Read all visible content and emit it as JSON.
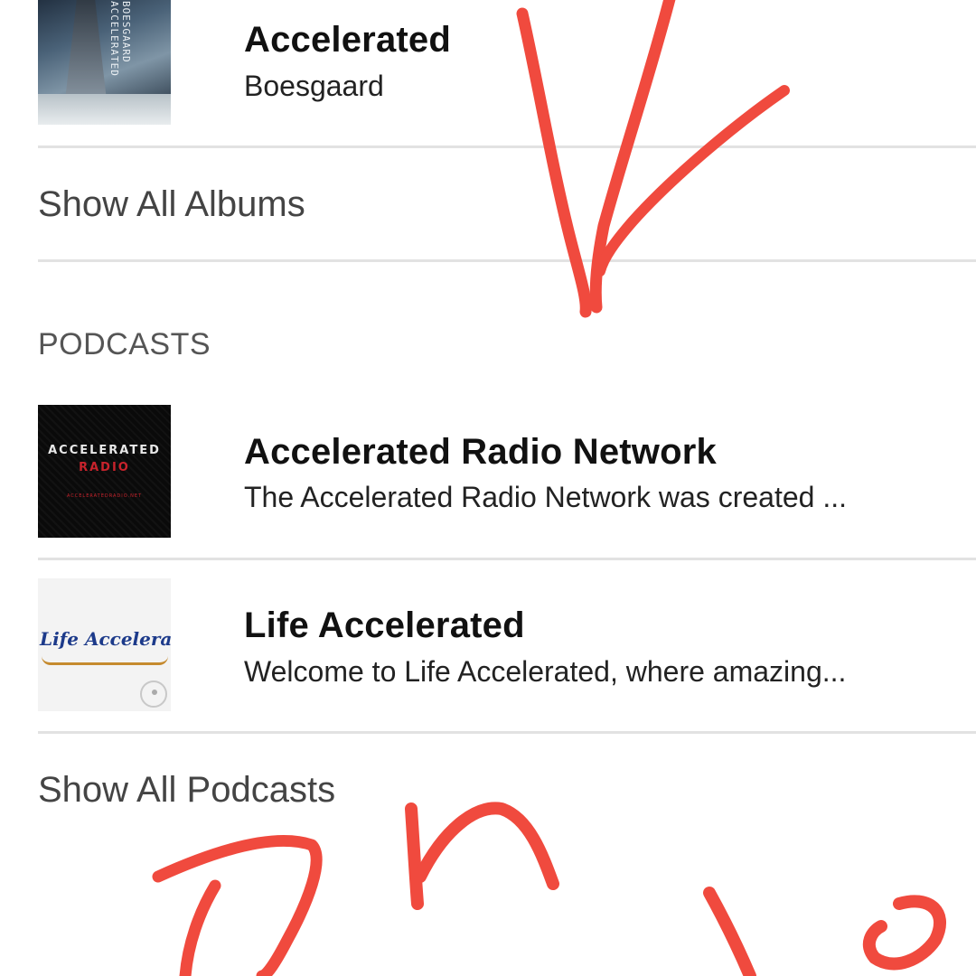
{
  "albums": {
    "items": [
      {
        "title": "Accelerated",
        "subtitle": "Boesgaard",
        "art_text": "BOESGAARD ACCELERATED"
      }
    ],
    "show_all_label": "Show All Albums"
  },
  "podcasts": {
    "section_title": "PODCASTS",
    "items": [
      {
        "title": "Accelerated Radio Network",
        "subtitle": "The Accelerated Radio Network was created ...",
        "art_line1": "ACCELERATED",
        "art_line2": "RADIO",
        "art_line3": "ACCELERATEDRADIO.NET"
      },
      {
        "title": "Life Accelerated",
        "subtitle": "Welcome to Life Accelerated, where amazing...",
        "art_text": "Life Accelerated"
      }
    ],
    "show_all_label": "Show All Podcasts"
  },
  "colors": {
    "ink": "#f04a3e",
    "divider": "#e2e2e2",
    "section_text": "#555555"
  },
  "annotation_icon": "hand-drawn-scribble"
}
